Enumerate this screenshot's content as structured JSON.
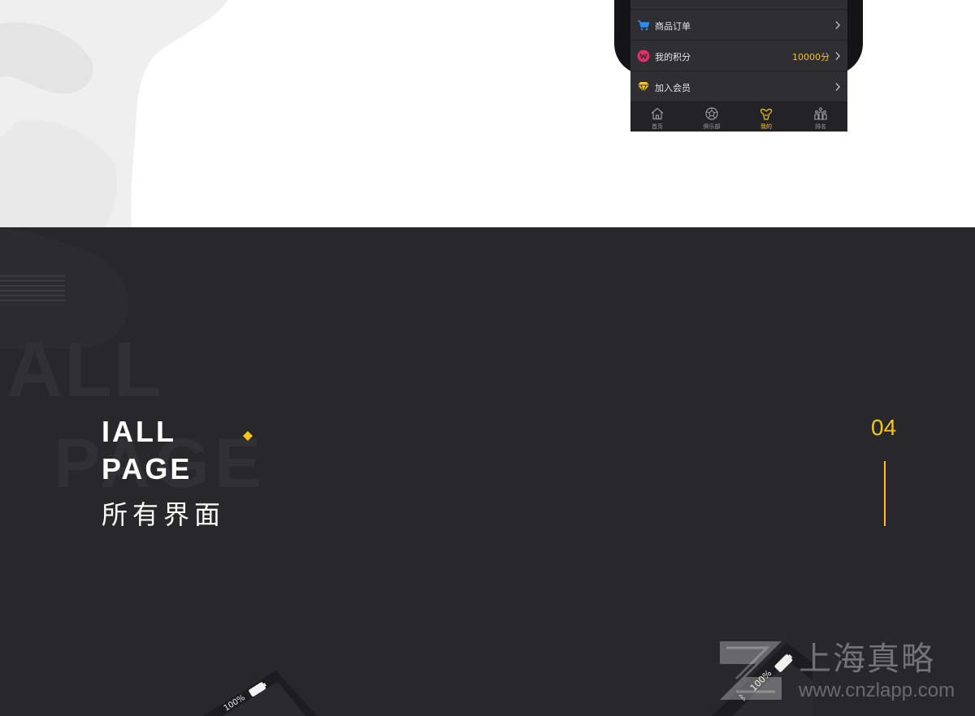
{
  "phone": {
    "menu": [
      {
        "label": "商品订单",
        "value": "",
        "icon": "cart-icon",
        "icon_color": "#2d8cf0"
      },
      {
        "label": "我的积分",
        "value": "10000分",
        "icon": "points-icon",
        "icon_color": "#e0306a"
      },
      {
        "label": "加入会员",
        "value": "",
        "icon": "diamond-icon",
        "icon_color": "#f5c518"
      }
    ],
    "tabs": [
      {
        "label": "首页",
        "icon": "home-icon",
        "active": false
      },
      {
        "label": "俱乐部",
        "icon": "club-icon",
        "active": false
      },
      {
        "label": "我的",
        "icon": "profile-icon",
        "active": true
      },
      {
        "label": "排名",
        "icon": "ranking-icon",
        "active": false
      }
    ],
    "accent_color": "#f5c518"
  },
  "section": {
    "background_text_1": "ALL",
    "background_text_2": "PAGE",
    "title_line1": "IALL",
    "title_line2": "PAGE",
    "subtitle": "所有界面",
    "number": "04",
    "accent_color": "#f5c518"
  },
  "tilted_phones": [
    {
      "battery": "100%"
    },
    {
      "battery": "100%"
    }
  ],
  "watermark": {
    "name": "上海真略",
    "url": "www.cnzlapp.com"
  }
}
